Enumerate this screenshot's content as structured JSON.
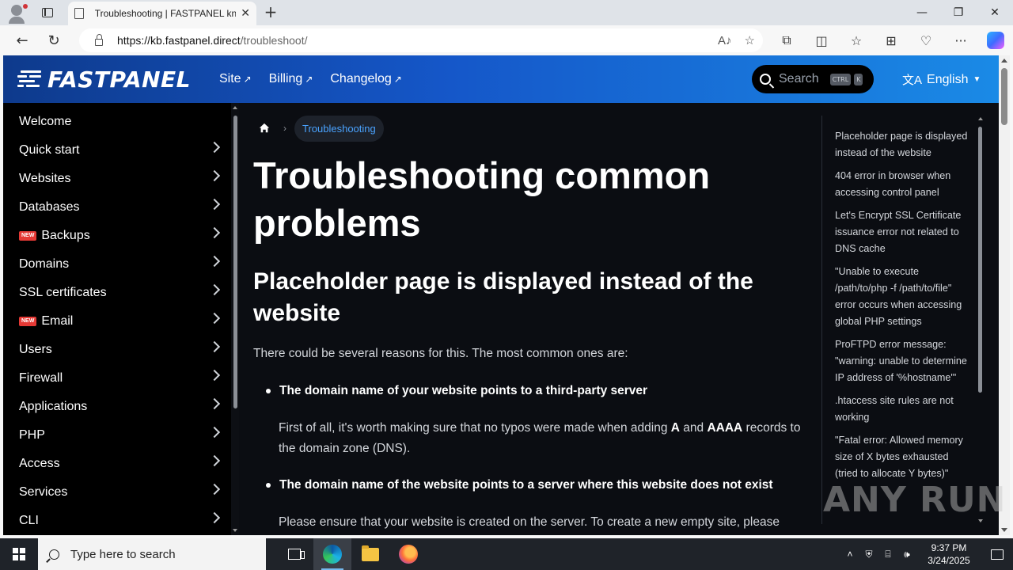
{
  "browser": {
    "tab_title": "Troubleshooting | FASTPANEL knowledge base",
    "url_host": "https://kb.fastpanel.direct",
    "url_path": "/troubleshoot/",
    "new_tab": "+",
    "close_tab": "✕"
  },
  "site": {
    "logo_text": "FASTPANEL",
    "nav": [
      {
        "label": "Site"
      },
      {
        "label": "Billing"
      },
      {
        "label": "Changelog"
      }
    ],
    "search": {
      "placeholder": "Search",
      "kbd1": "CTRL",
      "kbd2": "K"
    },
    "language": "English"
  },
  "sidebar": {
    "items": [
      {
        "label": "Welcome",
        "badge": "",
        "chevron": false
      },
      {
        "label": "Quick start",
        "badge": "",
        "chevron": true
      },
      {
        "label": "Websites",
        "badge": "",
        "chevron": true
      },
      {
        "label": "Databases",
        "badge": "",
        "chevron": true
      },
      {
        "label": "Backups",
        "badge": "NEW",
        "chevron": true
      },
      {
        "label": "Domains",
        "badge": "",
        "chevron": true
      },
      {
        "label": "SSL certificates",
        "badge": "",
        "chevron": true
      },
      {
        "label": "Email",
        "badge": "NEW",
        "chevron": true
      },
      {
        "label": "Users",
        "badge": "",
        "chevron": true
      },
      {
        "label": "Firewall",
        "badge": "",
        "chevron": true
      },
      {
        "label": "Applications",
        "badge": "",
        "chevron": true
      },
      {
        "label": "PHP",
        "badge": "",
        "chevron": true
      },
      {
        "label": "Access",
        "badge": "",
        "chevron": true
      },
      {
        "label": "Services",
        "badge": "",
        "chevron": true
      },
      {
        "label": "CLI",
        "badge": "",
        "chevron": true
      }
    ]
  },
  "main": {
    "breadcrumb_current": "Troubleshooting",
    "title": "Troubleshooting common problems",
    "section_title": "Placeholder page is displayed instead of the website",
    "intro": "There could be several reasons for this. The most common ones are:",
    "bullet1": "The domain name of your website points to a third-party server",
    "para1_a": "First of all, it's worth making sure that no typos were made when adding ",
    "para1_b1": "A",
    "para1_and": " and ",
    "para1_b2": "AAAA",
    "para1_c": " records to the domain zone (DNS).",
    "bullet2": "The domain name of the website points to a server where this website does not exist",
    "para2": "Please ensure that your website is created on the server. To create a new empty site, please"
  },
  "toc": {
    "items": [
      "Placeholder page is displayed instead of the website",
      "404 error in browser when accessing control panel",
      "Let's Encrypt SSL Certificate issuance error not related to DNS cache",
      "\"Unable to execute /path/to/php -f /path/to/file\" error occurs when accessing global PHP settings",
      "ProFTPD error message: \"warning: unable to determine IP address of '%hostname'\"",
      ".htaccess site rules are not working",
      "\"Fatal error: Allowed memory size of X bytes exhausted (tried to allocate Y bytes)\""
    ]
  },
  "watermark": "ANY RUN",
  "taskbar": {
    "search_placeholder": "Type here to search",
    "time": "9:37 PM",
    "date": "3/24/2025"
  },
  "colors": {
    "header_gradient_start": "#0e3a8c",
    "header_gradient_end": "#1a8ae6",
    "sidebar_bg": "#000000",
    "main_bg": "#0b0d12",
    "link_blue": "#4aa3ff",
    "new_badge": "#e53935"
  }
}
